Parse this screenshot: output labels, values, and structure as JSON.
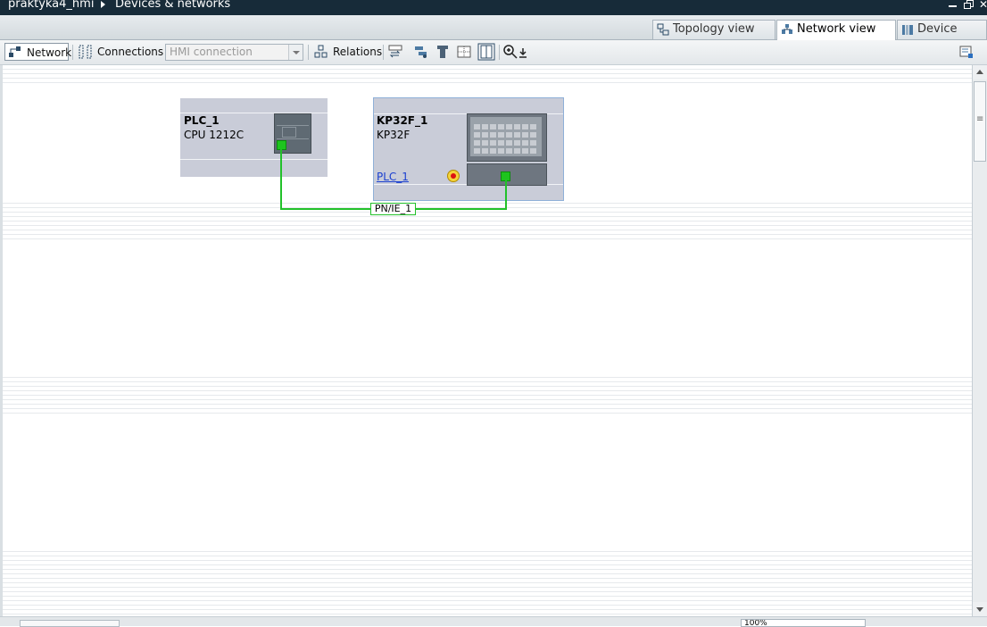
{
  "titlebar": {
    "project": "praktyka4_hmi",
    "section": "Devices & networks"
  },
  "view_tabs": [
    {
      "label": "Topology view",
      "icon": "topology-icon",
      "active": false
    },
    {
      "label": "Network view",
      "icon": "network-icon",
      "active": true
    },
    {
      "label": "Device view",
      "icon": "device-icon",
      "active": false
    }
  ],
  "toolbar": {
    "network_label": "Network",
    "connections_label": "Connections",
    "connection_type": "HMI connection",
    "relations_label": "Relations"
  },
  "devices": {
    "plc": {
      "name": "PLC_1",
      "type": "CPU 1212C"
    },
    "hmi": {
      "name": "KP32F_1",
      "type": "KP32F",
      "connected_plc": "PLC_1"
    }
  },
  "network": {
    "label": "PN/IE_1",
    "color": "#22c12a"
  },
  "zoom": {
    "value": "100%"
  }
}
